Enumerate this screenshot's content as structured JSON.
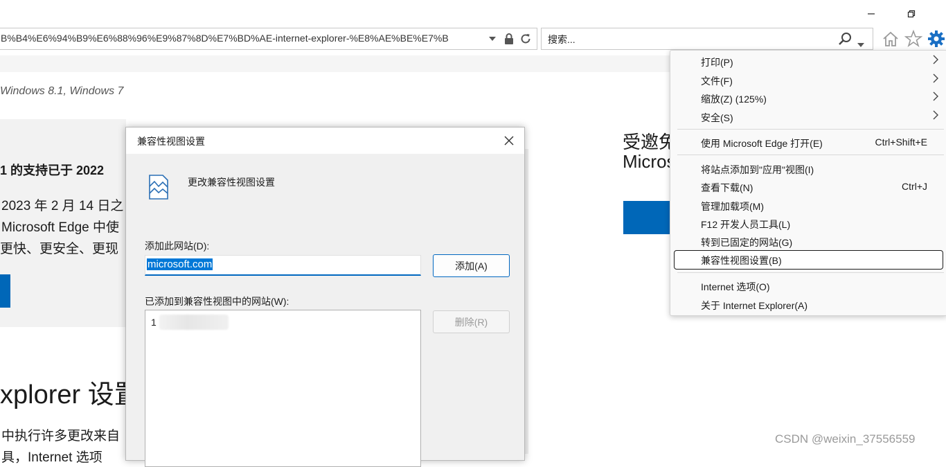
{
  "browser": {
    "address_url": "B%B4%E6%94%B9%E6%88%96%E9%87%8D%E7%BD%AE-internet-explorer-%E8%AE%BE%E7%B",
    "search_placeholder": "搜索...",
    "window_controls": [
      "minimize-icon",
      "restore-icon"
    ],
    "toolbar_icons": [
      "home-icon",
      "favorites-star-icon",
      "tools-gear-icon"
    ]
  },
  "page": {
    "os_line": "Windows 8.1, Windows 7",
    "support_title": "1 的支持已于 2022 ",
    "para1": "2023 年 2 月 14 日之",
    "para2": "Microsoft Edge 中使",
    "para3": "更快、更安全、更现",
    "heading": "xplorer 设置",
    "para4": "中执行许多更改来自",
    "para5": "具，Internet 选项",
    "right_line1": "受邀免",
    "right_line2": "Micros",
    "watermark": "CSDN @weixin_37556559"
  },
  "dialog": {
    "title": "兼容性视图设置",
    "heading": "更改兼容性视图设置",
    "add_label": "添加此网站(D):",
    "site_input_value": "microsoft.com",
    "add_button": "添加(A)",
    "list_label": "已添加到兼容性视图中的网站(W):",
    "list_items": [
      "1"
    ],
    "remove_button": "删除(R)"
  },
  "menu": {
    "items": [
      {
        "label": "打印(P)",
        "shortcut": "",
        "submenu": true
      },
      {
        "label": "文件(F)",
        "shortcut": "",
        "submenu": true
      },
      {
        "label": "缩放(Z) (125%)",
        "shortcut": "",
        "submenu": true
      },
      {
        "label": "安全(S)",
        "shortcut": "",
        "submenu": true
      },
      {
        "label": "使用 Microsoft Edge 打开(E)",
        "shortcut": "Ctrl+Shift+E",
        "submenu": false
      },
      {
        "label": "将站点添加到\"应用\"视图(I)",
        "shortcut": "",
        "submenu": false
      },
      {
        "label": "查看下载(N)",
        "shortcut": "Ctrl+J",
        "submenu": false
      },
      {
        "label": "管理加载项(M)",
        "shortcut": "",
        "submenu": false
      },
      {
        "label": "F12 开发人员工具(L)",
        "shortcut": "",
        "submenu": false
      },
      {
        "label": "转到已固定的网站(G)",
        "shortcut": "",
        "submenu": false
      },
      {
        "label": "兼容性视图设置(B)",
        "shortcut": "",
        "submenu": false,
        "highlighted": true
      },
      {
        "label": "Internet 选项(O)",
        "shortcut": "",
        "submenu": false
      },
      {
        "label": "关于 Internet Explorer(A)",
        "shortcut": "",
        "submenu": false
      }
    ]
  },
  "colors": {
    "accent_blue": "#0067b8",
    "selection_blue": "#0078d7",
    "gear_blue": "#1a6fc4"
  }
}
